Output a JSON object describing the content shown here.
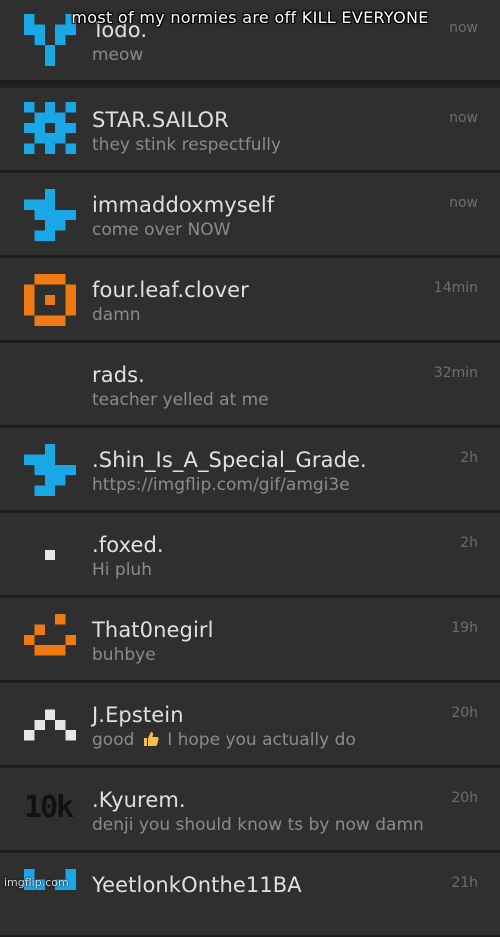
{
  "meme_caption": "most of my normies are off KILL EVERYONE",
  "watermark": "imgflip.com",
  "colors": {
    "blue": "#1aa7e6",
    "orange": "#f07a12",
    "row_bg": "#2f2f2f"
  },
  "chats": [
    {
      "name": "Todo.",
      "message": "meow",
      "time": "now",
      "avatar": "blue-pixel-heart-icon"
    },
    {
      "name": "STAR.SAILOR",
      "message": "they stink respectfully",
      "time": "now",
      "avatar": "blue-pixel-invader-icon"
    },
    {
      "name": "immaddoxmyself",
      "message": "come over NOW",
      "time": "now",
      "avatar": "blue-pixel-swirl-icon"
    },
    {
      "name": "four.leaf.clover",
      "message": "damn",
      "time": "14min",
      "avatar": "orange-pixel-target-icon"
    },
    {
      "name": "rads.",
      "message": "teacher yelled at me",
      "time": "32min",
      "avatar": ""
    },
    {
      "name": ".Shin_Is_A_Special_Grade.",
      "message": "https://imgflip.com/gif/amgi3e",
      "time": "2h",
      "avatar": "blue-pixel-swirl-icon"
    },
    {
      "name": ".foxed.",
      "message": "Hi pluh",
      "time": "2h",
      "avatar": "white-pixel-dot-icon"
    },
    {
      "name": "That0negirl",
      "message": "buhbye",
      "time": "19h",
      "avatar": "orange-pixel-smile-icon"
    },
    {
      "name": "J.Epstein",
      "message_before": "good",
      "message_emoji": "thumbs-up-icon",
      "message_after": "I hope you actually do",
      "time": "20h",
      "avatar": "white-pixel-mountain-icon"
    },
    {
      "name": ".Kyurem.",
      "message": "denji you should know ts by now damn",
      "time": "20h",
      "avatar_text": "10k"
    },
    {
      "name": "YeetlonkOnthe11BA",
      "message": "",
      "time": "21h",
      "avatar": "blue-pixel-heart-icon"
    }
  ]
}
